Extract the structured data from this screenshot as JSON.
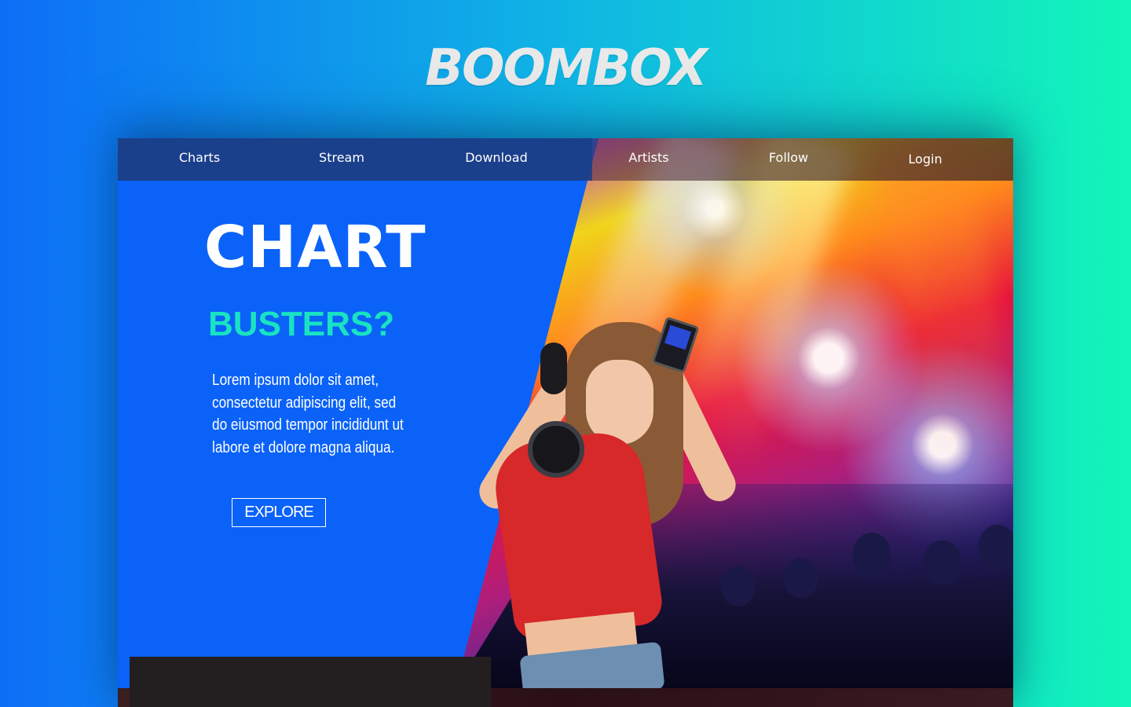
{
  "brand": {
    "name": "BOOMBOX"
  },
  "nav": {
    "items": [
      "Charts",
      "Stream",
      "Download",
      "Artists",
      "Follow"
    ],
    "login": "Login"
  },
  "hero": {
    "title": "CHART",
    "subtitle": "BUSTERS?",
    "text": "Lorem ipsum dolor sit amet, consectetur adipiscing elit, sed do eiusmod tempor incididunt ut labore et dolore magna aliqua.",
    "button": "EXPLORE"
  },
  "colors": {
    "accent_blue": "#0a62f8",
    "accent_teal": "#19e3c2",
    "tank_top_red": "#d7282a"
  }
}
